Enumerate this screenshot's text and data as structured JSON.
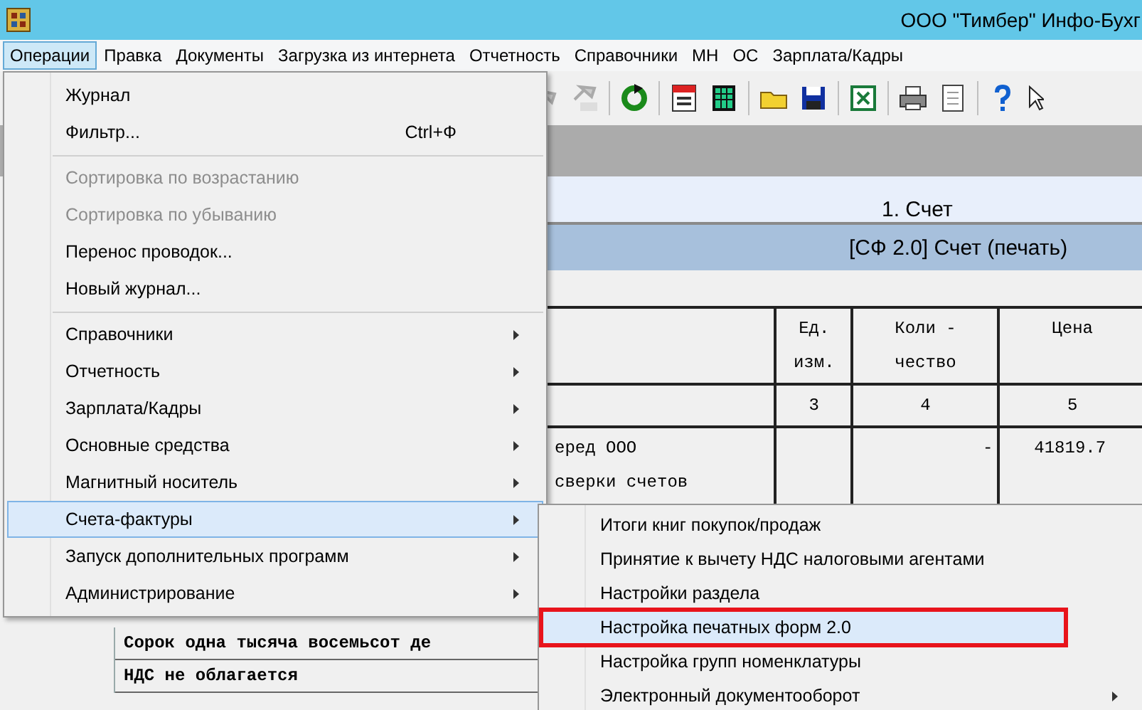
{
  "window": {
    "title": "ООО \"Тимбер\" Инфо-Бухг"
  },
  "menubar": [
    {
      "label": "Операции",
      "selected": true
    },
    {
      "label": "Правка",
      "selected": false
    },
    {
      "label": "Документы",
      "selected": false
    },
    {
      "label": "Загрузка из интернета",
      "selected": false
    },
    {
      "label": "Отчетность",
      "selected": false
    },
    {
      "label": "Справочники",
      "selected": false
    },
    {
      "label": "МН",
      "selected": false
    },
    {
      "label": "ОС",
      "selected": false
    },
    {
      "label": "Зарплата/Кадры",
      "selected": false
    }
  ],
  "document": {
    "band_title": "1. Счет",
    "form_title": "[СФ 2.0] Счет (печать)",
    "table": {
      "columns": [
        "Ед. изм.",
        "Коли - чество",
        "Цена"
      ],
      "numbers": [
        "3",
        "4",
        "5"
      ],
      "row": {
        "column_1": [
          "еред ООО",
          "сверки счетов"
        ],
        "column_3": "-",
        "column_4": "41819.7"
      }
    },
    "lines": [
      "Сорок одна тысяча восемьсот де",
      "НДС не облагается"
    ]
  },
  "menu": [
    {
      "kind": "command",
      "label": "Журнал",
      "disabled": false,
      "selected": false
    },
    {
      "kind": "command",
      "label": "Фильтр...",
      "shortcut": "Ctrl+Ф",
      "disabled": false,
      "selected": false
    },
    {
      "kind": "separator"
    },
    {
      "kind": "command",
      "label": "Сортировка по возрастанию",
      "disabled": true,
      "selected": false
    },
    {
      "kind": "command",
      "label": "Сортировка по убыванию",
      "disabled": true,
      "selected": false
    },
    {
      "kind": "command",
      "label": "Перенос проводок...",
      "disabled": false,
      "selected": false
    },
    {
      "kind": "command",
      "label": "Новый журнал...",
      "disabled": false,
      "selected": false
    },
    {
      "kind": "separator"
    },
    {
      "kind": "submenu",
      "label": "Справочники",
      "disabled": false,
      "selected": false
    },
    {
      "kind": "submenu",
      "label": "Отчетность",
      "disabled": false,
      "selected": false
    },
    {
      "kind": "submenu",
      "label": "Зарплата/Кадры",
      "disabled": false,
      "selected": false
    },
    {
      "kind": "submenu",
      "label": "Основные средства",
      "disabled": false,
      "selected": false
    },
    {
      "kind": "submenu",
      "label": "Магнитный носитель",
      "disabled": false,
      "selected": false
    },
    {
      "kind": "submenu",
      "label": "Счета-фактуры",
      "disabled": false,
      "selected": true
    },
    {
      "kind": "submenu",
      "label": "Запуск дополнительных программ",
      "disabled": false,
      "selected": false
    },
    {
      "kind": "submenu",
      "label": "Администрирование",
      "disabled": false,
      "selected": false
    }
  ],
  "submenu": [
    {
      "kind": "command",
      "label": "Итоги книг покупок/продаж",
      "selected": false,
      "highlighted": false
    },
    {
      "kind": "command",
      "label": "Принятие к вычету НДС налоговыми агентами",
      "selected": false,
      "highlighted": false
    },
    {
      "kind": "command",
      "label": "Настройки раздела",
      "selected": false,
      "highlighted": false
    },
    {
      "kind": "command",
      "label": "Настройка печатных форм 2.0",
      "selected": true,
      "highlighted": true
    },
    {
      "kind": "command",
      "label": "Настройка групп номенклатуры",
      "selected": false,
      "highlighted": false
    },
    {
      "kind": "submenu",
      "label": "Электронный документооборот",
      "selected": false,
      "highlighted": false
    }
  ]
}
